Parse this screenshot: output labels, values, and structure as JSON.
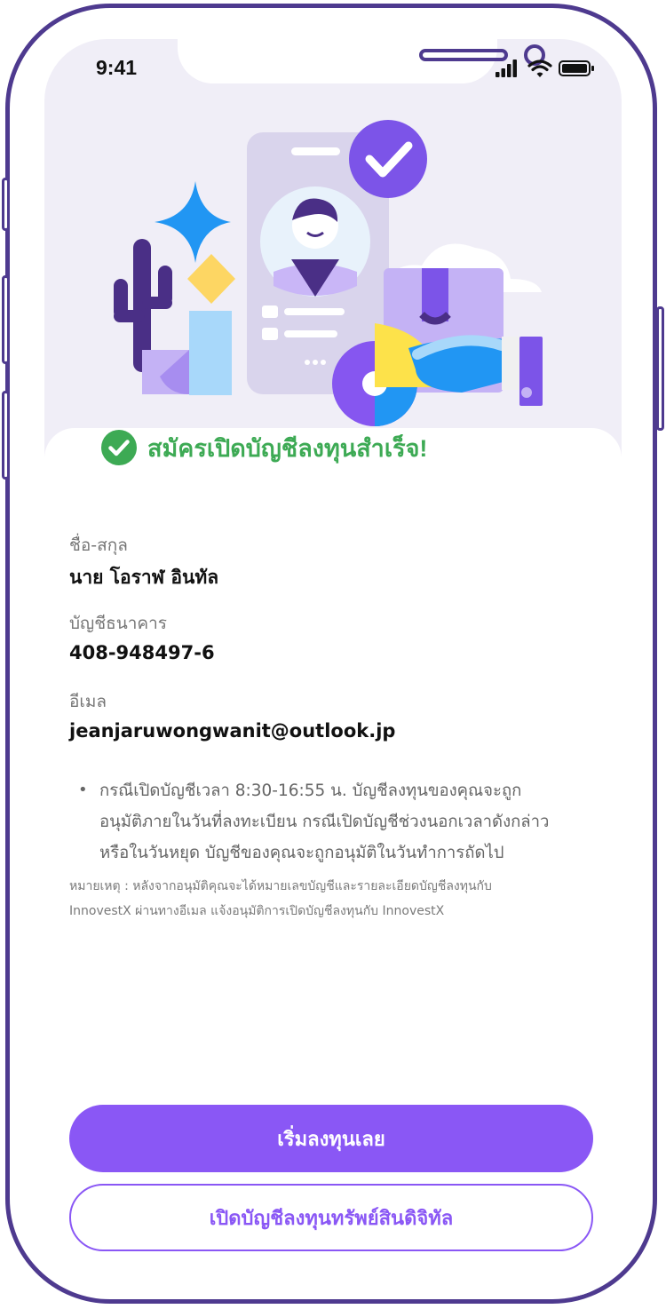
{
  "status_bar": {
    "time": "9:41"
  },
  "success": {
    "title": "สมัครเปิดบัญชีลงทุนสำเร็จ!"
  },
  "details": [
    {
      "label": "ชื่อ-สกุล",
      "value": "นาย โอราฬ อินทัล"
    },
    {
      "label": "บัญชีธนาคาร",
      "value": "408-948497-6"
    },
    {
      "label": "อีเมล",
      "value": "jeanjaruwongwanit@outlook.jp"
    }
  ],
  "note": {
    "bullet": "•",
    "bullet_lines": [
      "กรณีเปิดบัญชีเวลา 8:30-16:55 น. บัญชีลงทุนของคุณจะถูก",
      "อนุมัติภายในวันที่ลงทะเบียน กรณีเปิดบัญชีช่วงนอกเวลาดังกล่าว",
      "หรือในวันหยุด บัญชีของคุณจะถูกอนุมัติในวันทำการถัดไป"
    ],
    "remark_lines": [
      "หมายเหตุ : หลังจากอนุมัติคุณจะได้หมายเลขบัญชีและรายละเอียดบัญชีลงทุนกับ",
      "InnovestX ผ่านทางอีเมล แจ้งอนุมัติการเปิดบัญชีลงทุนกับ InnovestX"
    ]
  },
  "buttons": {
    "primary": "เริ่มลงทุนเลย",
    "secondary": "เปิดบัญชีลงทุนทรัพย์สินดิจิทัล"
  },
  "colors": {
    "accent": "#8a57f5",
    "success": "#3daa54",
    "frame": "#4e3a8f"
  },
  "icons": [
    "signal-icon",
    "wifi-icon",
    "battery-icon",
    "check-circle-icon"
  ]
}
